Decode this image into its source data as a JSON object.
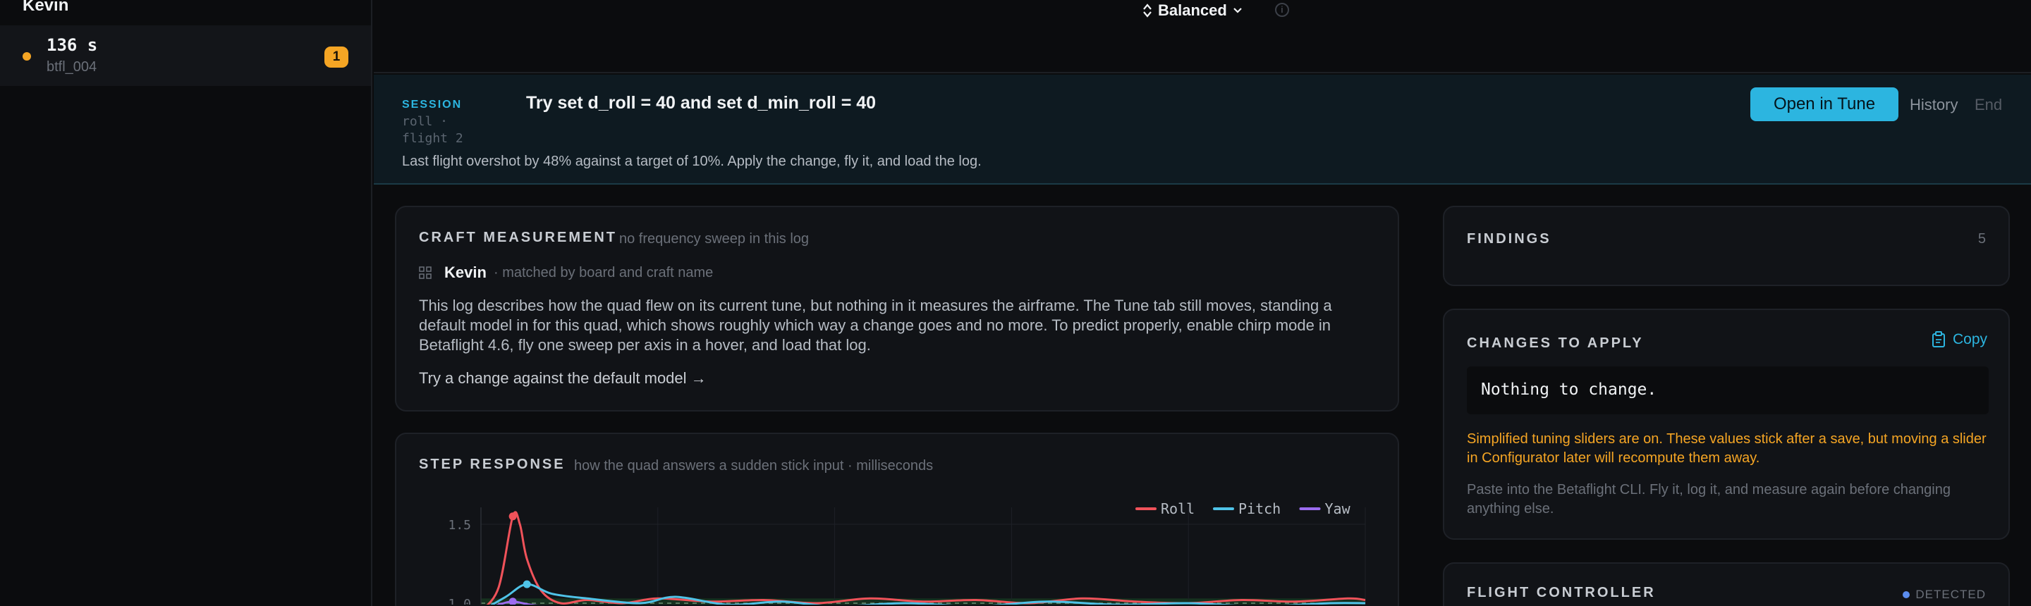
{
  "sidebar": {
    "title": "Kevin",
    "session": {
      "duration": "136 s",
      "file": "btfl_004",
      "badge": "1"
    }
  },
  "topbar": {
    "mode": "Balanced",
    "info_icon": "info-icon"
  },
  "banner": {
    "tag": "SESSION",
    "sub1": "roll ·",
    "sub2": "flight 2",
    "title": "Try set d_roll = 40 and set d_min_roll = 40",
    "description": "Last flight overshot by 48% against a target of 10%. Apply the change, fly it, and load the log.",
    "open_label": "Open in Tune",
    "history_label": "History",
    "end_label": "End"
  },
  "craft": {
    "heading": "CRAFT MEASUREMENT",
    "note": "no frequency sweep in this log",
    "name": "Kevin",
    "match": "· matched by board and craft name",
    "body": "This log describes how the quad flew on its current tune, but nothing in it measures the airframe. The Tune tab still moves, standing a default model in for this quad, which shows roughly which way a change goes and no more. To predict properly, enable chirp mode in Betaflight 4.6, fly one sweep per axis in a hover, and load that log.",
    "link": "Try a change against the default model →"
  },
  "step": {
    "heading": "STEP RESPONSE",
    "note": "how the quad answers a sudden stick input · milliseconds"
  },
  "chart_data": {
    "type": "line",
    "title": "",
    "xlabel": "",
    "ylabel": "",
    "y_ticks": [
      "1.5",
      "1.0"
    ],
    "ylim": [
      0.95,
      1.6
    ],
    "xlim": [
      0,
      500
    ],
    "grid": true,
    "legend": "top-right",
    "target_band": [
      0.97,
      1.03
    ],
    "series": [
      {
        "name": "Roll",
        "color": "#f0525a",
        "x": [
          0,
          10,
          18,
          22,
          26,
          34,
          45,
          60,
          80,
          100,
          130,
          160,
          190,
          220,
          250,
          280,
          310,
          340,
          370,
          400,
          430,
          460,
          490,
          500
        ],
        "y": [
          0.95,
          1.1,
          1.55,
          1.5,
          1.28,
          1.08,
          1.0,
          1.02,
          1.0,
          1.03,
          1.01,
          1.02,
          1.0,
          1.03,
          1.01,
          1.02,
          1.0,
          1.03,
          1.01,
          1.0,
          1.02,
          1.01,
          1.03,
          1.02
        ]
      },
      {
        "name": "Pitch",
        "color": "#4fc3e8",
        "x": [
          0,
          14,
          26,
          40,
          60,
          90,
          110,
          140,
          170,
          200,
          240,
          280,
          320,
          360,
          400,
          440,
          480,
          500
        ],
        "y": [
          0.95,
          1.04,
          1.12,
          1.06,
          1.03,
          1.0,
          1.04,
          0.99,
          1.01,
          0.98,
          1.0,
          0.98,
          1.01,
          0.99,
          1.0,
          0.98,
          1.0,
          1.0
        ]
      },
      {
        "name": "Yaw",
        "color": "#9b6cf0",
        "x": [
          0,
          10,
          18,
          28,
          40,
          80,
          140,
          200,
          260,
          320,
          380,
          440,
          500
        ],
        "y": [
          0.95,
          0.99,
          1.01,
          0.99,
          0.98,
          0.97,
          0.98,
          0.97,
          0.98,
          0.97,
          0.98,
          0.97,
          0.98
        ]
      }
    ]
  },
  "findings": {
    "heading": "FINDINGS",
    "count": "5"
  },
  "changes": {
    "heading": "CHANGES TO APPLY",
    "copy_label": "Copy",
    "nothing": "Nothing to change.",
    "warning": "Simplified tuning sliders are on. These values stick after a save, but moving a slider in Configurator later will recompute them away.",
    "paste": "Paste into the Betaflight CLI. Fly it, log it, and measure again before changing anything else."
  },
  "flight_controller": {
    "heading": "FLIGHT CONTROLLER",
    "status": "DETECTED"
  },
  "colors": {
    "accent": "#2cb5e0",
    "warning": "#f5a524",
    "roll": "#f0525a",
    "pitch": "#4fc3e8",
    "yaw": "#9b6cf0"
  }
}
